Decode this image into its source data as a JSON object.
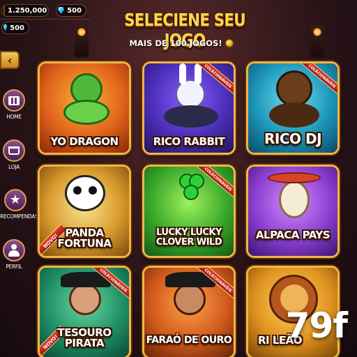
{
  "header": {
    "coins_value": "1.250,000",
    "gems_value": "500",
    "gems2_value": "500",
    "title": "SELECIENE SEU JOGO",
    "subtitle": "MAIS DE 100 JOGOS!"
  },
  "back_button": {
    "label": "‹"
  },
  "sidebar": {
    "items": [
      {
        "label": "HOME",
        "icon": "home-grid-icon"
      },
      {
        "label": "LOJA",
        "icon": "cart-icon"
      },
      {
        "label": "RECOMPENDAS",
        "icon": "star-icon"
      },
      {
        "label": "PERFIL",
        "icon": "user-icon"
      }
    ]
  },
  "games": [
    {
      "name": "YO DRAGON",
      "ribbon": "",
      "novo": ""
    },
    {
      "name": "RICO RABBIT",
      "ribbon": "COLECIONÁVEIS",
      "novo": ""
    },
    {
      "name": "RICO DJ",
      "ribbon": "COLECIONÁVEIS",
      "novo": ""
    },
    {
      "name": "PANDA FORTUNA",
      "ribbon": "",
      "novo": "NOVO!"
    },
    {
      "name": "LUCKY LUCKY CLOVER WILD",
      "ribbon": "COLECIONÁVEIS",
      "novo": ""
    },
    {
      "name": "ALPACA PAYS",
      "ribbon": "",
      "novo": ""
    },
    {
      "name": "TESOURO PIRATA",
      "ribbon": "COLECIONÁVEIS",
      "novo": "NOVO!"
    },
    {
      "name": "FARAÓ DE OURO",
      "ribbon": "COLECIONÁVEIS",
      "novo": ""
    },
    {
      "name": "RI LEÃO",
      "ribbon": "",
      "novo": ""
    }
  ],
  "watermark": "79f",
  "colors": {
    "accent_gold": "#f0b648",
    "title_yellow": "#ffd74a",
    "sidebar_purple": "#6b3270",
    "ribbon_red": "#c8281f"
  }
}
